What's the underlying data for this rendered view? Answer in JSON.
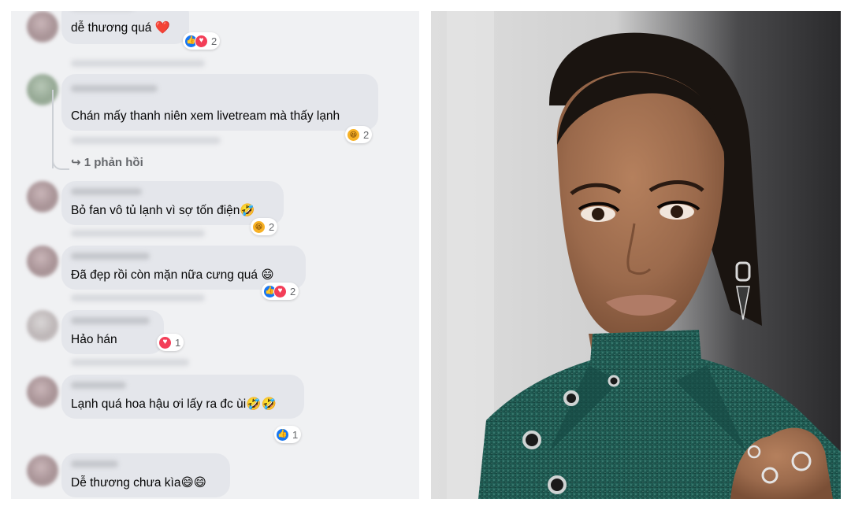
{
  "comments": [
    {
      "text": "dễ thương quá ❤️",
      "reactions": [
        "like",
        "love"
      ],
      "count": "2"
    },
    {
      "text": "Chán mấy thanh niên xem livetream mà thấy lạnh",
      "reactions": [
        "haha"
      ],
      "count": "2"
    },
    {
      "text": "Bỏ fan vô tủ lạnh vì sợ tốn điện🤣",
      "reactions": [
        "haha"
      ],
      "count": "2"
    },
    {
      "text": "Đã đẹp rồi còn mặn nữa cưng quá 😄",
      "reactions": [
        "like",
        "love"
      ],
      "count": "2"
    },
    {
      "text": "Hảo hán",
      "reactions": [
        "love"
      ],
      "count": "1"
    },
    {
      "text": "Lạnh quá hoa hậu ơi lấy ra đc ùi🤣🤣",
      "reactions": [
        "like"
      ],
      "count": "1"
    },
    {
      "text": "Dễ thương chưa kìa😄😄",
      "reactions": [],
      "count": ""
    }
  ],
  "reply_link": "↪ 1 phản hồi",
  "photo": {
    "description": "Portrait photo of a woman with slicked-back dark hair, bold eye makeup, drop earrings and a sparkly teal high-neck outfit with grommets",
    "colors": {
      "background_light": "#d8d8d8",
      "background_dark": "#2e2e30",
      "outfit": "#1f5a52",
      "skin": "#9b6a4c",
      "hair": "#1a1410"
    }
  },
  "icons": {
    "like": "thumbs-up-icon",
    "love": "heart-icon",
    "haha": "laughing-face-icon"
  },
  "colors": {
    "bubble": "#e4e6eb",
    "panel_bg": "#f0f1f3",
    "like_blue": "#1877f2",
    "love_red": "#f33e58",
    "haha_yellow": "#f7b125"
  }
}
